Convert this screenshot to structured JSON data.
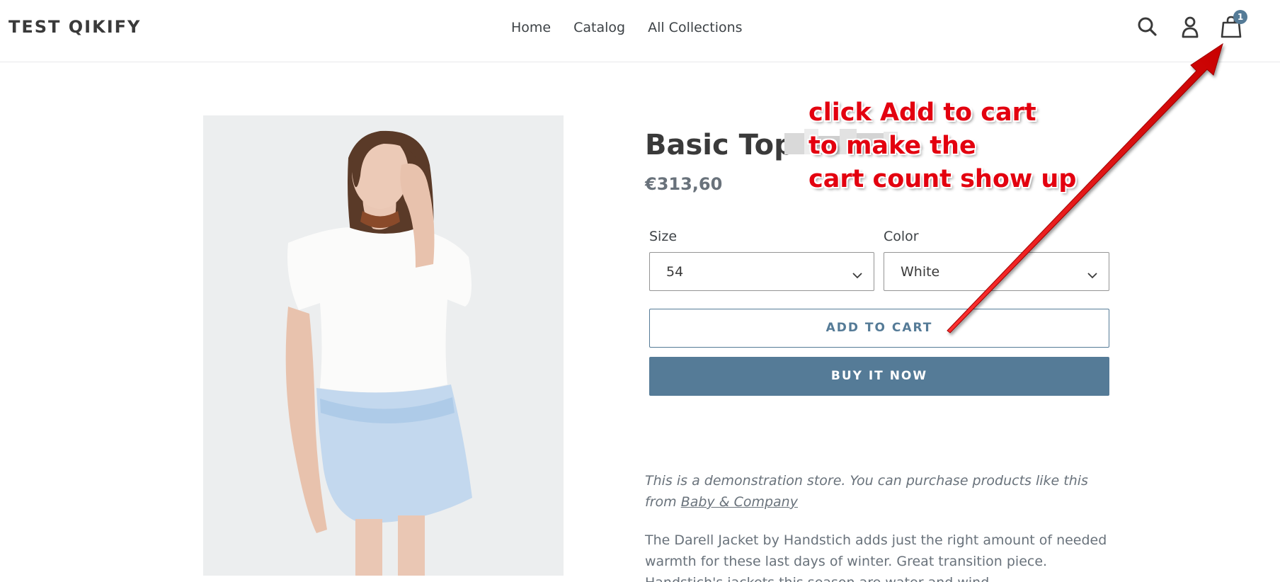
{
  "header": {
    "logo": "TEST QIKIFY",
    "nav": [
      "Home",
      "Catalog",
      "All Collections"
    ],
    "cart_count": "1",
    "icons": [
      "search-icon",
      "user-icon",
      "cart-icon"
    ]
  },
  "product": {
    "title": "Basic Top",
    "price": "€313,60",
    "size_label": "Size",
    "size_value": "54",
    "color_label": "Color",
    "color_value": "White",
    "add_to_cart": "ADD TO CART",
    "buy_now": "BUY IT NOW",
    "demo_note_prefix": "This is a demonstration store. You can purchase products like this from",
    "demo_note_link": "Baby & Company",
    "description": "The Darell Jacket by Handstich adds just the right amount of needed warmth for these last days of winter. Great transition piece. Handstich's jackets this season are water and wind"
  },
  "annotation": {
    "lines": [
      "click Add to cart",
      "to make the",
      "cart count show up"
    ]
  },
  "colors": {
    "accent": "#557b97",
    "annotation": "#e3000f"
  }
}
